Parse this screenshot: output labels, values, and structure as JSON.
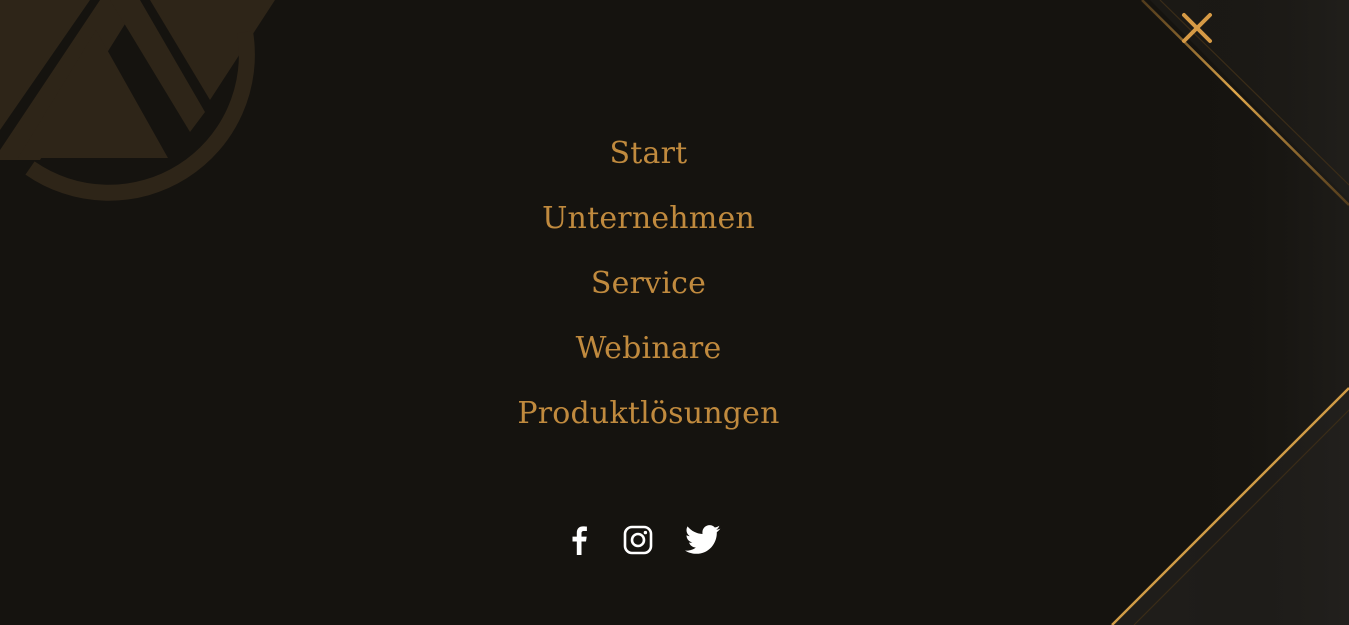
{
  "colors": {
    "background": "#15130f",
    "accent_gold": "#c08a3e",
    "close_icon": "#d69a45",
    "social_icon": "#ffffff"
  },
  "close_button": {
    "icon": "close-icon"
  },
  "menu": {
    "items": [
      {
        "label": "Start"
      },
      {
        "label": "Unternehmen"
      },
      {
        "label": "Service"
      },
      {
        "label": "Webinare"
      },
      {
        "label": "Produktlösungen"
      }
    ]
  },
  "social": {
    "items": [
      {
        "icon": "facebook-icon"
      },
      {
        "icon": "instagram-icon"
      },
      {
        "icon": "twitter-icon"
      }
    ]
  }
}
